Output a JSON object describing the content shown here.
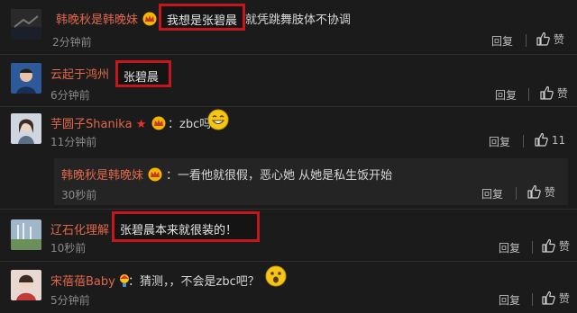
{
  "comments": [
    {
      "user": "韩晚秋是韩晚妹",
      "highlight": "我想是张碧晨",
      "text": "就凭跳舞肢体不协调",
      "time": "2分钟前",
      "reply": "回复",
      "like": "赞"
    },
    {
      "user": "云起于鸿州",
      "highlight": "张碧晨",
      "time": "6分钟前",
      "reply": "回复",
      "like": "赞"
    },
    {
      "user": "芋圆子Shanika",
      "text": "：zbc吗",
      "time": "11分钟前",
      "reply": "回复",
      "like": "11"
    },
    {
      "user": "韩晚秋是韩晚妹",
      "text": "：一看他就很假，恶心她 从她是私生饭开始",
      "time": "30秒前",
      "reply": "回复",
      "like": "赞"
    },
    {
      "user": "辽石化理解",
      "highlight": "张碧晨本来就很装的！",
      "time": "10秒前",
      "reply": "回复",
      "like": "赞"
    },
    {
      "user": "宋蓓蓓Baby",
      "text": "：猜测，，不会是zbc吧？",
      "time": "5分钟前",
      "reply": "回复",
      "like": "赞"
    }
  ],
  "icons": {
    "like": "thumbs-up-icon",
    "vip": "crown-badge-icon",
    "star": "red-star-icon",
    "emoji_laugh": "grin-emoji-icon",
    "emoji_shock": "surprised-emoji-icon",
    "bulb": "bulb-badge-icon"
  },
  "colors": {
    "username": "#e0674a",
    "highlight_box": "#c4161c",
    "background": "#1b1b1b"
  }
}
